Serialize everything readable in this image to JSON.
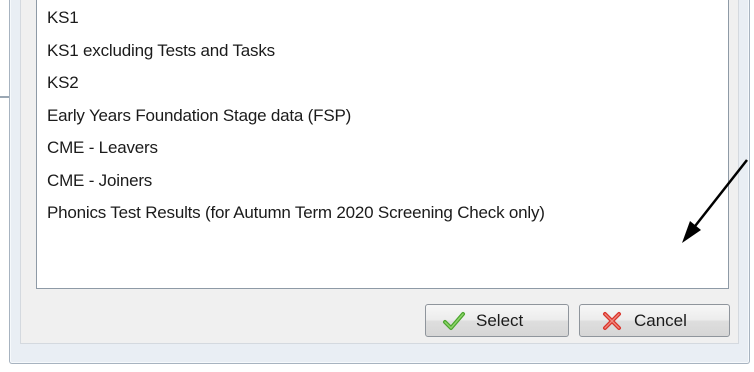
{
  "list": {
    "items": [
      "KS1",
      "KS1 excluding Tests and Tasks",
      "KS2",
      "Early Years Foundation Stage data (FSP)",
      "CME - Leavers",
      "CME - Joiners",
      "Phonics Test Results (for Autumn Term 2020 Screening Check only)"
    ]
  },
  "buttons": {
    "select_label": "Select",
    "cancel_label": "Cancel"
  },
  "icons": {
    "select": "checkmark-icon",
    "cancel": "cross-icon"
  },
  "colors": {
    "dialog_background": "#e9eef4",
    "check_green": "#4aa52e",
    "cross_red": "#d9342b",
    "arrow": "#000000"
  }
}
